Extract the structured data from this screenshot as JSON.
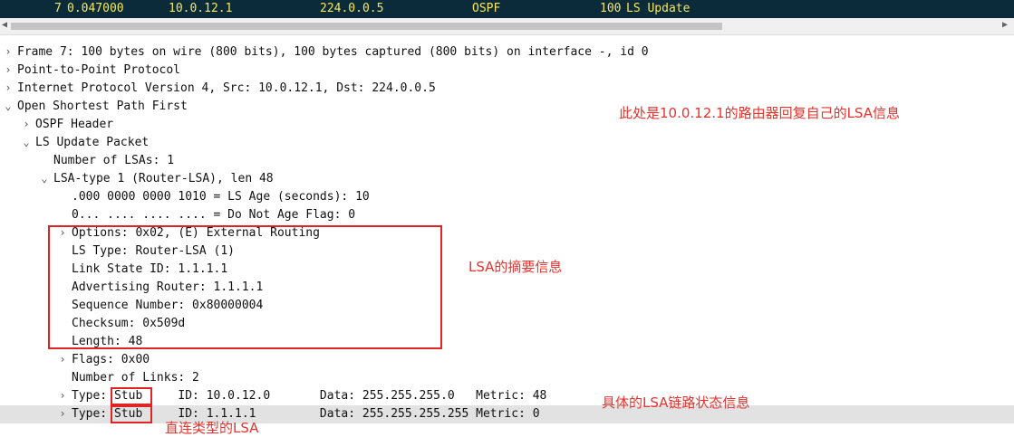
{
  "packet_list": {
    "row": {
      "no": "7",
      "time": "0.047000",
      "source": "10.0.12.1",
      "destination": "224.0.0.5",
      "protocol": "OSPF",
      "length": "100",
      "info": "LS Update"
    }
  },
  "details": [
    {
      "text": "Frame 7: 100 bytes on wire (800 bits), 100 bytes captured (800 bits) on interface -, id 0",
      "chevron": "right"
    },
    {
      "text": "Point-to-Point Protocol",
      "chevron": "right"
    },
    {
      "text": "Internet Protocol Version 4, Src: 10.0.12.1, Dst: 224.0.0.5",
      "chevron": "right"
    },
    {
      "text": "Open Shortest Path First",
      "chevron": "down"
    },
    {
      "text": "OSPF Header",
      "chevron": "right"
    },
    {
      "text": "LS Update Packet",
      "chevron": "down"
    },
    {
      "text": "Number of LSAs: 1",
      "chevron": ""
    },
    {
      "text": "LSA-type 1 (Router-LSA), len 48",
      "chevron": "down"
    },
    {
      "text": ".000 0000 0000 1010 = LS Age (seconds): 10",
      "chevron": ""
    },
    {
      "text": "0... .... .... .... = Do Not Age Flag: 0",
      "chevron": ""
    },
    {
      "text": "Options: 0x02, (E) External Routing",
      "chevron": "right"
    },
    {
      "text": "LS Type: Router-LSA (1)",
      "chevron": ""
    },
    {
      "text": "Link State ID: 1.1.1.1",
      "chevron": ""
    },
    {
      "text": "Advertising Router: 1.1.1.1",
      "chevron": ""
    },
    {
      "text": "Sequence Number: 0x80000004",
      "chevron": ""
    },
    {
      "text": "Checksum: 0x509d",
      "chevron": ""
    },
    {
      "text": "Length: 48",
      "chevron": ""
    },
    {
      "text": "Flags: 0x00",
      "chevron": "right"
    },
    {
      "text": "Number of Links: 2",
      "chevron": ""
    },
    {
      "text": "Type: Stub     ID: 10.0.12.0       Data: 255.255.255.0   Metric: 48",
      "chevron": "right"
    },
    {
      "text": "Type: Stub     ID: 1.1.1.1         Data: 255.255.255.255 Metric: 0",
      "chevron": "right"
    }
  ],
  "annotations": {
    "router_reply": "此处是10.0.12.1的路由器回复自己的LSA信息",
    "lsa_summary": "LSA的摘要信息",
    "lsa_link_state": "具体的LSA链路状态信息",
    "direct_type": "直连类型的LSA"
  },
  "icons": {
    "expand": "chevron-right-icon",
    "collapse": "chevron-down-icon"
  },
  "colors": {
    "packet_bg": "#0b2a3a",
    "packet_fg": "#f5e85a",
    "annotation": "#e8322e",
    "selected_row": "#e2e2e2"
  }
}
